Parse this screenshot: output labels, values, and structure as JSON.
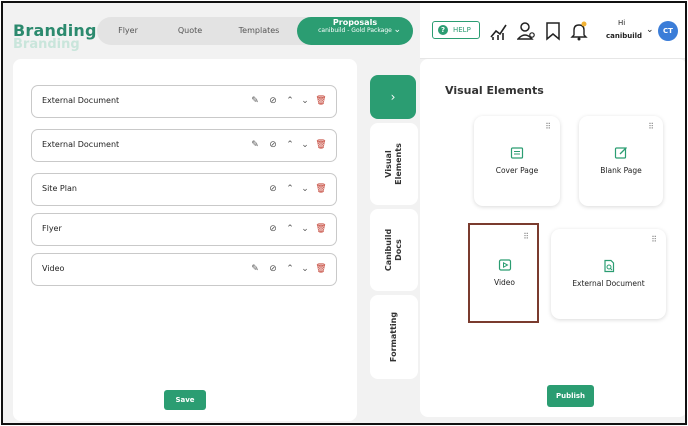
{
  "brand": {
    "name": "Branding"
  },
  "tabs": [
    {
      "label": "Flyer"
    },
    {
      "label": "Quote"
    },
    {
      "label": "Templates"
    }
  ],
  "active_tab": {
    "label": "Proposals",
    "sublabel": "canibuild - Gold Package"
  },
  "header": {
    "help_label": "HELP",
    "greeting": "Hi",
    "username": "canibuild",
    "avatar_initials": "CT"
  },
  "document_items": [
    {
      "label": "External Document"
    },
    {
      "label": "External Document"
    },
    {
      "label": "Site Plan"
    },
    {
      "label": "Flyer"
    },
    {
      "label": "Video"
    }
  ],
  "save_label": "Save",
  "side_tabs": {
    "visual_elements": "Visual Elements",
    "canibuild_docs": "Canibuild Docs",
    "formatting": "Formatting"
  },
  "visual_elements": {
    "title": "Visual Elements",
    "cards": [
      {
        "label": "Cover Page",
        "icon": "cover-page-icon"
      },
      {
        "label": "Blank Page",
        "icon": "blank-page-icon"
      },
      {
        "label": "Video",
        "icon": "video-icon"
      },
      {
        "label": "External Document",
        "icon": "external-document-icon"
      }
    ]
  },
  "publish_label": "Publish",
  "colors": {
    "accent": "#2b9d72",
    "highlight": "#7a3b2e",
    "avatar": "#3b7dd8"
  }
}
